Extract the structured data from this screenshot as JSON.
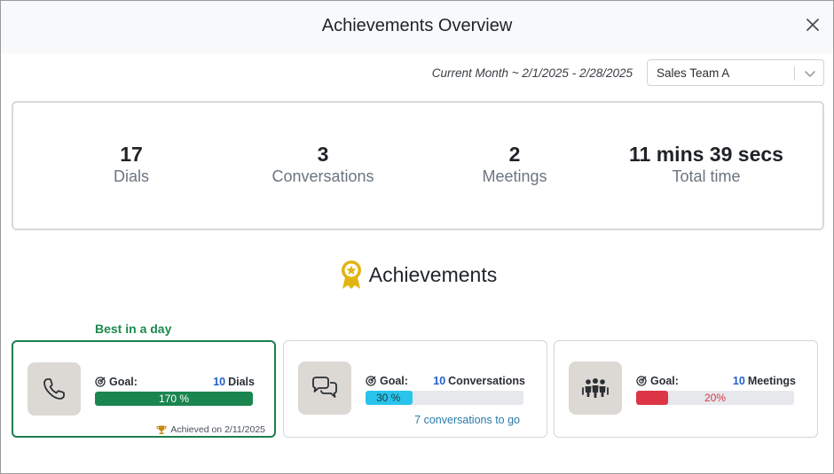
{
  "header": {
    "title": "Achievements Overview"
  },
  "filters": {
    "period": "Current Month ~ 2/1/2025 - 2/28/2025",
    "team": "Sales Team A"
  },
  "stats": [
    {
      "value": "17",
      "label": "Dials"
    },
    {
      "value": "3",
      "label": "Conversations"
    },
    {
      "value": "2",
      "label": "Meetings"
    },
    {
      "value": "11 mins 39 secs",
      "label": "Total time"
    }
  ],
  "achievements": {
    "title": "Achievements",
    "best_label": "Best in a day",
    "cards": [
      {
        "goal_label": "Goal:",
        "goal_num": "10",
        "goal_unit": "Dials",
        "progress_pct": 100,
        "progress_text": "170 %",
        "bar_color": "#1b8550",
        "text_color": "#ffffff",
        "note": "Achieved on 2/11/2025"
      },
      {
        "goal_label": "Goal:",
        "goal_num": "10",
        "goal_unit": "Conversations",
        "progress_pct": 30,
        "progress_text": "30 %",
        "bar_color": "#29c4ea",
        "text_color": "#1b3a4a",
        "note": "7 conversations to go"
      },
      {
        "goal_label": "Goal:",
        "goal_num": "10",
        "goal_unit": "Meetings",
        "progress_pct": 20,
        "progress_text": "20%",
        "bar_color": "#dc3545",
        "text_color": "#dc3545",
        "note": ""
      }
    ]
  },
  "colors": {
    "accent_green": "#1b8a4c",
    "link_blue": "#2560c8",
    "medal_gold": "#e2b410"
  }
}
